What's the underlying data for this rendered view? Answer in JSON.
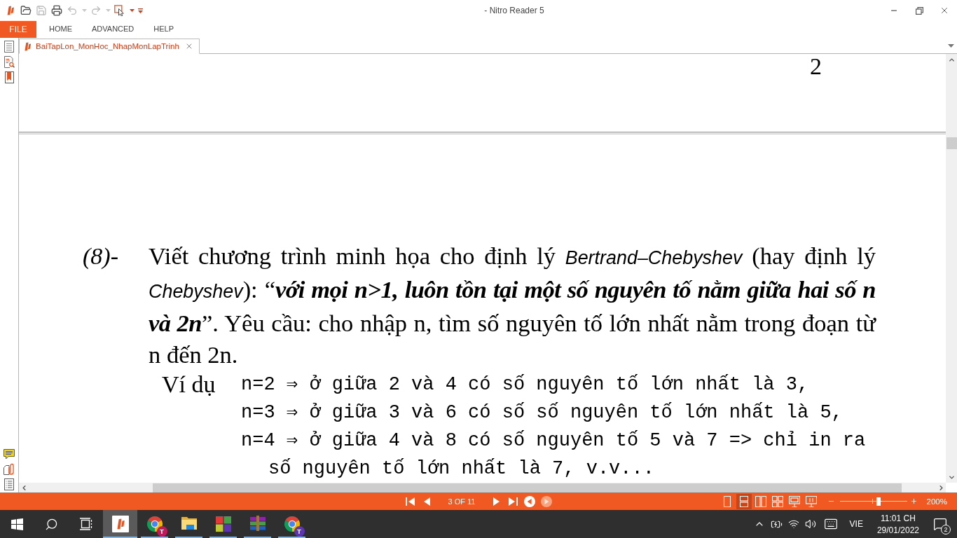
{
  "window": {
    "title": "- Nitro Reader 5"
  },
  "quick_access": [
    {
      "kind": "open",
      "disabled": false
    },
    {
      "kind": "save",
      "disabled": true
    },
    {
      "kind": "print",
      "disabled": false
    },
    {
      "kind": "undo",
      "disabled": true
    },
    {
      "kind": "redo",
      "disabled": true
    },
    {
      "kind": "select",
      "disabled": false
    }
  ],
  "ribbon": {
    "file_tab": "FILE",
    "tabs": [
      {
        "label": "HOME",
        "selected": false
      },
      {
        "label": "ADVANCED",
        "selected": false
      },
      {
        "label": "HELP",
        "selected": false
      }
    ]
  },
  "document_tabs": [
    {
      "label": "BaiTapLon_MonHoc_NhapMonLapTrinh",
      "selected": true
    }
  ],
  "document": {
    "previous_page_number": "2",
    "item_number": "(8)-",
    "paragraph": "Viết chương trình minh họa cho định lý *Bertrand–Chebyshev* (hay định lý *Chebyshev*): “**với mọi n>1, luôn tồn tại một số nguyên tố nằm giữa hai số n và 2n**”. Yêu cầu: cho nhập n, tìm số nguyên tố lớn nhất nằm trong đoạn từ n đến 2n.",
    "example_label": "Ví dụ",
    "examples": [
      {
        "text": "n=2 ⇒ ở giữa 2 và 4 có số nguyên tố lớn nhất là 3,"
      },
      {
        "text": "n=3 ⇒ ở giữa 3 và 6 có số số nguyên tố lớn nhất là 5,"
      },
      {
        "text": "n=4 ⇒ ở giữa 4 và 8 có số nguyên tố 5 và 7 => chỉ in ra",
        "continuation": "số nguyên tố lớn nhất là 7, v.v..."
      }
    ]
  },
  "status_bar": {
    "nav_before": [
      {
        "kind": "first",
        "disabled": false
      },
      {
        "kind": "previous",
        "disabled": false
      }
    ],
    "page_indicator": "3 OF 11",
    "nav_after": [
      {
        "kind": "next",
        "disabled": false
      },
      {
        "kind": "last",
        "disabled": false
      },
      {
        "kind": "back",
        "disabled": false
      },
      {
        "kind": "forward",
        "disabled": true
      }
    ],
    "view_modes": [
      {
        "kind": "single",
        "selected": false
      },
      {
        "kind": "continuous",
        "selected": true
      },
      {
        "kind": "facing",
        "selected": false
      },
      {
        "kind": "facing_continuous",
        "selected": false
      },
      {
        "kind": "monitor",
        "selected": false
      },
      {
        "kind": "monitor_split",
        "selected": false
      }
    ],
    "zoom": {
      "level": 0.58,
      "reading": "200%"
    }
  },
  "taskbar": {
    "apps": [
      {
        "kind": "nitro",
        "active": true
      },
      {
        "kind": "chrome",
        "active": false,
        "badge": {
          "text": "T",
          "color": "#c2185b"
        }
      },
      {
        "kind": "explorer",
        "active": false
      },
      {
        "kind": "tiles",
        "active": false
      },
      {
        "kind": "archive",
        "active": false
      },
      {
        "kind": "chrome",
        "active": false,
        "badge": {
          "text": "T",
          "color": "#5e35b1"
        }
      }
    ],
    "tray": {
      "language": "VIE",
      "time": "11:01 CH",
      "date": "29/01/2022",
      "notification_count": "2"
    }
  }
}
